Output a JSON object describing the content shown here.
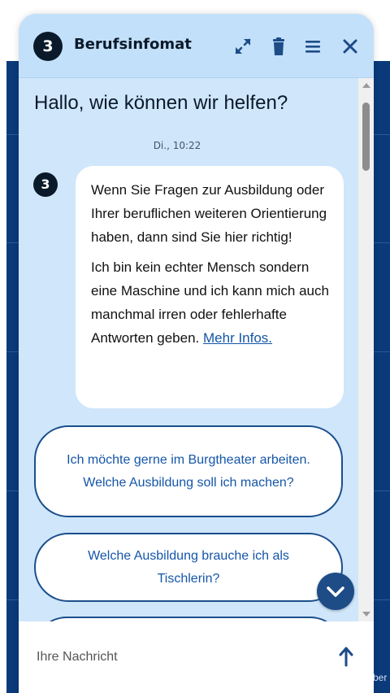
{
  "header": {
    "logo_letter": "3",
    "title": "Berufsinfomat",
    "icons": [
      "expand-icon",
      "trash-icon",
      "menu-icon",
      "close-icon"
    ]
  },
  "chat": {
    "greeting": "Hallo, wie können wir helfen?",
    "timestamp": "Di., 10:22",
    "bot_avatar_letter": "3",
    "message_p1": "Wenn Sie Fragen zur Ausbildung oder Ihrer beruflichen weiteren Orientierung haben, dann sind Sie hier richtig!",
    "message_p2": "Ich bin kein echter Mensch sondern eine Maschine und ich kann mich auch manchmal irren oder fehlerhafte Antworten geben.",
    "more_info_link": "Mehr Infos."
  },
  "suggestions": [
    "Ich möchte gerne im Burgtheater arbeiten. Welche Ausbildung soll ich machen?",
    "Welche Ausbildung brauche ich als Tischlerin?",
    ""
  ],
  "input": {
    "placeholder": "Ihre Nachricht"
  },
  "background": {
    "corner_text": "ber"
  },
  "colors": {
    "widget_bg": "#cfe6fb",
    "header_bg": "#c3e0fa",
    "accent": "#1d4c87",
    "link": "#1556a8",
    "page_bg": "#0a3a7a"
  }
}
